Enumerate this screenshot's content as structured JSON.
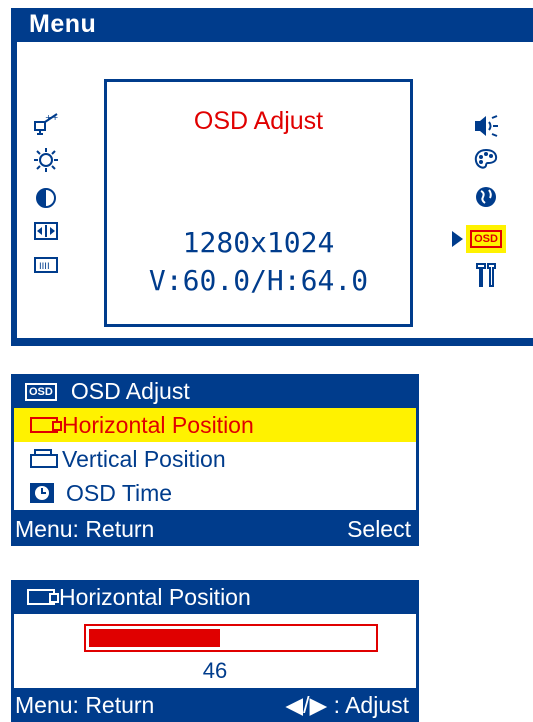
{
  "main_menu": {
    "title": "Menu",
    "preview_title": "OSD Adjust",
    "resolution": "1280x1024",
    "frequency": "V:60.0/H:64.0",
    "left_icons": [
      "auto-adjust-icon",
      "brightness-icon",
      "contrast-icon",
      "position-icon",
      "clock-phase-icon"
    ],
    "right_icons": [
      "audio-icon",
      "color-icon",
      "language-icon",
      "osd-icon",
      "tools-icon"
    ],
    "osd_icon_text": "OSD",
    "selected_item": "osd-icon"
  },
  "submenu": {
    "title": "OSD Adjust",
    "header_icon_text": "OSD",
    "items": [
      {
        "label": "Horizontal Position",
        "icon": "horizontal-position-icon",
        "selected": true
      },
      {
        "label": "Vertical Position",
        "icon": "vertical-position-icon",
        "selected": false
      },
      {
        "label": "OSD Time",
        "icon": "osd-time-icon",
        "selected": false
      }
    ],
    "footer_left": "Menu: Return",
    "footer_right": "Select"
  },
  "horizontal_position": {
    "title": "Horizontal Position",
    "value": "46",
    "fill_percent": 46,
    "footer_left": "Menu: Return",
    "footer_right": ": Adjust",
    "adjust_arrows": "◀/▶"
  },
  "colors": {
    "panel_blue": "#003c8c",
    "highlight_yellow": "#fff200",
    "accent_red": "#e00000"
  }
}
